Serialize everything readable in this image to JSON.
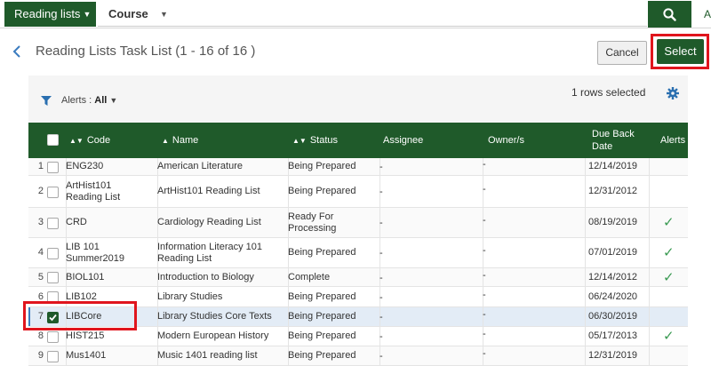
{
  "search": {
    "scope_label": "Reading lists",
    "type_label": "Course",
    "value": "",
    "advanced_label": "A"
  },
  "header": {
    "title": "Reading Lists Task List (1 - 16 of 16 )",
    "cancel_label": "Cancel",
    "select_label": "Select"
  },
  "toolbar": {
    "alerts_label": "Alerts :",
    "alerts_value": "All",
    "rows_selected": "1 rows selected"
  },
  "table": {
    "columns": {
      "code": "Code",
      "name": "Name",
      "status": "Status",
      "assignee": "Assignee",
      "owners": "Owner/s",
      "due_line1": "Due Back",
      "due_line2": "Date",
      "alerts": "Alerts"
    },
    "rows": [
      {
        "num": "1",
        "code": "ENG230",
        "name": "American Literature",
        "status": "Being Prepared",
        "assignee": "-",
        "owners": "-",
        "due": "12/14/2019",
        "alert": "",
        "checked": false
      },
      {
        "num": "2",
        "code": "ArtHist101 Reading List",
        "name": "ArtHist101 Reading List",
        "status": "Being Prepared",
        "assignee": "-",
        "owners": "-",
        "due": "12/31/2012",
        "alert": "",
        "checked": false
      },
      {
        "num": "3",
        "code": "CRD",
        "name": "Cardiology Reading List",
        "status": "Ready For Processing",
        "assignee": "-",
        "owners": "-",
        "due": "08/19/2019",
        "alert": "✓",
        "checked": false
      },
      {
        "num": "4",
        "code": "LIB 101 Summer2019",
        "name": "Information Literacy 101 Reading List",
        "status": "Being Prepared",
        "assignee": "-",
        "owners": "-",
        "due": "07/01/2019",
        "alert": "✓",
        "checked": false
      },
      {
        "num": "5",
        "code": "BIOL101",
        "name": "Introduction to Biology",
        "status": "Complete",
        "assignee": "-",
        "owners": "-",
        "due": "12/14/2012",
        "alert": "✓",
        "checked": false
      },
      {
        "num": "6",
        "code": "LIB102",
        "name": "Library Studies",
        "status": "Being Prepared",
        "assignee": "-",
        "owners": "-",
        "due": "06/24/2020",
        "alert": "",
        "checked": false
      },
      {
        "num": "7",
        "code": "LIBCore",
        "name": "Library Studies Core Texts",
        "status": "Being Prepared",
        "assignee": "-",
        "owners": "-",
        "due": "06/30/2019",
        "alert": "",
        "checked": true
      },
      {
        "num": "8",
        "code": "HIST215",
        "name": "Modern European History",
        "status": "Being Prepared",
        "assignee": "-",
        "owners": "-",
        "due": "05/17/2013",
        "alert": "✓",
        "checked": false
      },
      {
        "num": "9",
        "code": "Mus1401",
        "name": "Music 1401 reading list",
        "status": "Being Prepared",
        "assignee": "-",
        "owners": "-",
        "due": "12/31/2019",
        "alert": "",
        "checked": false
      }
    ]
  },
  "colors": {
    "brand_green": "#1f5a2a",
    "highlight_red": "#e0151d",
    "check_green": "#3a9a52",
    "selected_row": "#e3ecf6"
  },
  "icons": [
    "search-icon",
    "back-chevron-icon",
    "filter-icon",
    "gear-icon",
    "checkmark-icon",
    "caret-down-icon"
  ]
}
